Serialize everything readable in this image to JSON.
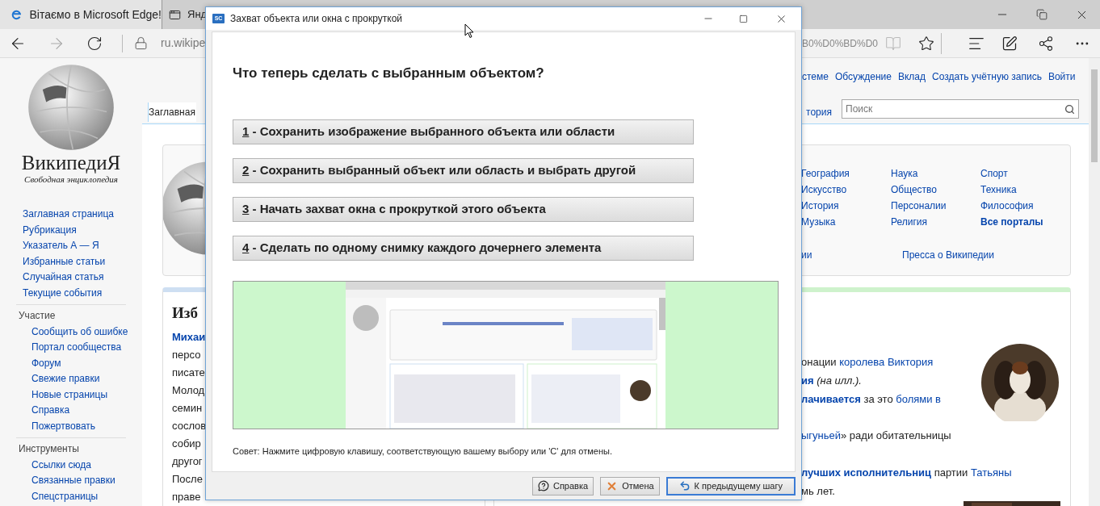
{
  "browser": {
    "tabs": [
      {
        "label": "Вітаємо в Microsoft Edge!",
        "selected": true
      },
      {
        "label": "Янд",
        "selected": false
      }
    ],
    "address_start": "ru.wikipe",
    "address_end": "B0%D0%BD%D0"
  },
  "wiki": {
    "logo_title": "ВикипедиЯ",
    "logo_tagline": "Свободная энциклопедия",
    "nav": [
      "Заглавная страница",
      "Рубрикация",
      "Указатель А — Я",
      "Избранные статьи",
      "Случайная статья",
      "Текущие события"
    ],
    "sections": [
      {
        "heading": "Участие",
        "items": [
          "Сообщить об ошибке",
          "Портал сообщества",
          "Форум",
          "Свежие правки",
          "Новые страницы",
          "Справка",
          "Пожертвовать"
        ]
      },
      {
        "heading": "Инструменты",
        "items": [
          "Ссылки сюда",
          "Связанные правки",
          "Спецстраницы"
        ]
      }
    ],
    "personal_links": [
      "стеме",
      "Обсуждение",
      "Вклад",
      "Создать учётную запись",
      "Войти"
    ],
    "page_tab": "Заглавная",
    "right_tab": "тория",
    "search_placeholder": "Поиск",
    "portals": [
      [
        {
          "label": "География",
          "bold": false
        },
        {
          "label": "Искусство",
          "bold": false
        },
        {
          "label": "История",
          "bold": false
        },
        {
          "label": "Музыка",
          "bold": false
        }
      ],
      [
        {
          "label": "Наука",
          "bold": false
        },
        {
          "label": "Общество",
          "bold": false
        },
        {
          "label": "Персоналии",
          "bold": false
        },
        {
          "label": "Религия",
          "bold": false
        }
      ],
      [
        {
          "label": "Спорт",
          "bold": false
        },
        {
          "label": "Техника",
          "bold": false
        },
        {
          "label": "Философия",
          "bold": false
        },
        {
          "label": "Все порталы",
          "bold": true
        }
      ]
    ],
    "portal_footer": [
      "ии",
      "Пресса о Википедии"
    ],
    "featured_heading": "Изб",
    "left_lines": [
      [
        {
          "kind": "bold_link",
          "text": "Михаи"
        }
      ],
      [
        {
          "kind": "plain",
          "text": "персо"
        }
      ],
      [
        {
          "kind": "plain",
          "text": "писате"
        }
      ],
      [
        {
          "kind": "plain",
          "text": "Молод"
        }
      ],
      [
        {
          "kind": "plain",
          "text": "семин"
        }
      ],
      [
        {
          "kind": "plain",
          "text": "сослов"
        }
      ],
      [
        {
          "kind": "plain",
          "text": "собир"
        }
      ],
      [
        {
          "kind": "plain",
          "text": "другог"
        }
      ],
      [
        {
          "kind": "plain",
          "text": "После"
        }
      ],
      [
        {
          "kind": "plain",
          "text": "праве"
        }
      ]
    ],
    "right_blocks": [
      [
        [
          {
            "kind": "plain",
            "text": "онации "
          },
          {
            "kind": "link",
            "text": "королева Виктория"
          }
        ],
        [
          {
            "kind": "bold_link",
            "text": "ия"
          },
          {
            "kind": "italic",
            "text": " (на илл.)."
          }
        ],
        [
          {
            "kind": "bold_link",
            "text": "лачивается"
          },
          {
            "kind": "plain",
            "text": " за это "
          },
          {
            "kind": "link",
            "text": "болями в"
          }
        ]
      ],
      [
        [
          {
            "kind": "link",
            "text": "ыгуньей"
          },
          {
            "kind": "plain",
            "text": "» ради обитательницы"
          }
        ]
      ],
      [
        [
          {
            "kind": "bold_link",
            "text": "лучших исполнительниц"
          },
          {
            "kind": "plain",
            "text": " партии "
          },
          {
            "kind": "link",
            "text": "Татьяны"
          }
        ],
        [
          {
            "kind": "plain",
            "text": "мь лет."
          }
        ]
      ]
    ]
  },
  "dialog": {
    "icon_text": "SC",
    "title": "Захват объекта или окна с прокруткой",
    "question": "Что теперь сделать с выбранным объектом?",
    "options": [
      {
        "key": "1",
        "label": "- Сохранить изображение выбранного объекта или области"
      },
      {
        "key": "2",
        "label": "- Сохранить выбранный объект или область и выбрать другой"
      },
      {
        "key": "3",
        "label": "- Начать захват окна с прокруткой этого объекта"
      },
      {
        "key": "4",
        "label": "- Сделать по одному снимку каждого дочернего элемента"
      }
    ],
    "tip": "Совет: Нажмите цифровую клавишу, соответствующую вашему выбору или 'C' для отмены.",
    "buttons": [
      {
        "kind": "help",
        "label": "Справка",
        "default": false
      },
      {
        "kind": "cancel",
        "label": "Отмена",
        "default": false
      },
      {
        "kind": "back",
        "label": "К предыдущему шагу",
        "default": true
      }
    ]
  }
}
